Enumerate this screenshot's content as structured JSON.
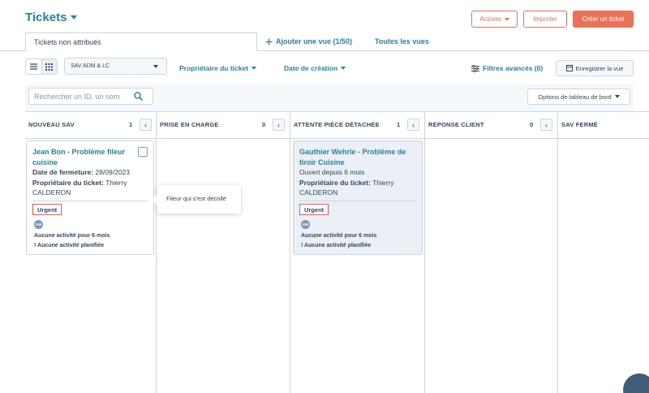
{
  "header": {
    "title": "Tickets",
    "actions_label": "Actions",
    "import_label": "Importer",
    "create_label": "Créer un ticket"
  },
  "tabs": {
    "active_tab": "Tickets non attribués",
    "add_view": "Ajouter une vue (1/50)",
    "all_views": "Toutes les vues"
  },
  "toolbar": {
    "pipeline": "SAV ADM & LC",
    "owner_filter": "Propriétaire du ticket",
    "date_filter": "Date de création",
    "advanced_filters": "Filtres avancés (0)",
    "save_view": "Enregistrer la vue"
  },
  "search": {
    "placeholder": "Rechercher un ID, un nom"
  },
  "dashboard_options": "Options de tableau de bord",
  "columns": [
    {
      "title": "NOUVEAU SAV",
      "count": "1"
    },
    {
      "title": "PRISE EN CHARGE",
      "count": "0"
    },
    {
      "title": "ATTENTE PIÈCE DÉTACHÉE",
      "count": "1"
    },
    {
      "title": "RÉPONSE CLIENT",
      "count": "0"
    },
    {
      "title": "SAV FERMÉ",
      "count": ""
    }
  ],
  "cards": [
    {
      "title_line1": "Jean Bon - Problème fileur",
      "title_line2": "cuisine",
      "line1_label": "Date de fermeture:",
      "line1_value": " 28/09/2023",
      "line2_label": "Propriétaire du ticket:",
      "line2_value": " Thierry",
      "line3": "CALDERON",
      "tag": "Urgent",
      "avatar": "GW",
      "activity1": "Aucune activité pour 6 mois",
      "activity2": "Aucune activité planifiée"
    },
    {
      "title_line1": "Gauthier Wehrle - Problème de",
      "title_line2": "tiroir Cuisine",
      "line1": "Ouvert depuis 6 mois",
      "line2_label": "Propriétaire du ticket:",
      "line2_value": " Thierry",
      "line3": "CALDERON",
      "tag": "Urgent",
      "avatar": "GW",
      "activity1": "Aucune activité pour 6 mois",
      "activity2": "Aucune activité planifiée"
    }
  ],
  "tooltip": "Fileur qui s'est décollé",
  "colors": {
    "accent": "#2d7f9d",
    "primary_button": "#e8725a",
    "urgent_border": "#f2545b"
  }
}
